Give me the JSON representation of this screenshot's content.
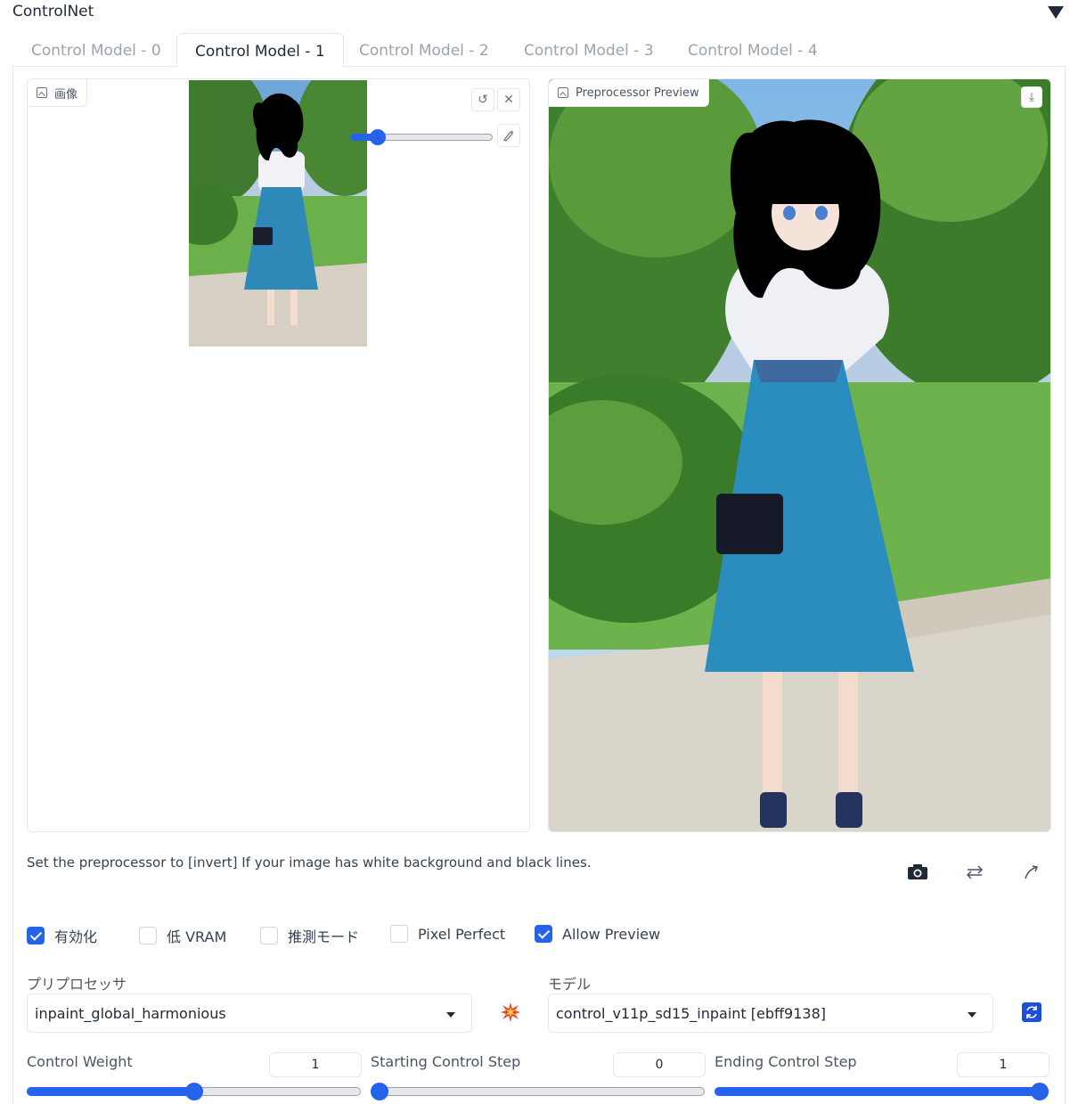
{
  "accordion": {
    "title": "ControlNet"
  },
  "tabs": [
    {
      "label": "Control Model - 0"
    },
    {
      "label": "Control Model - 1"
    },
    {
      "label": "Control Model - 2"
    },
    {
      "label": "Control Model - 3"
    },
    {
      "label": "Control Model - 4"
    }
  ],
  "image_panel": {
    "label": "画像"
  },
  "preview_panel": {
    "label": "Preprocessor Preview"
  },
  "hint": "Set the preprocessor to [invert] If your image has white background and black lines.",
  "checkboxes": [
    {
      "label": "有効化",
      "checked": true
    },
    {
      "label": "低 VRAM",
      "checked": false
    },
    {
      "label": "推測モード",
      "checked": false
    },
    {
      "label": "Pixel Perfect",
      "checked": false
    },
    {
      "label": "Allow Preview",
      "checked": true
    }
  ],
  "preprocessor": {
    "label": "プリプロセッサ",
    "value": "inpaint_global_harmonious"
  },
  "model": {
    "label": "モデル",
    "value": "control_v11p_sd15_inpaint [ebff9138]"
  },
  "sliders": [
    {
      "label": "Control Weight",
      "value": "1",
      "fraction": 0.5
    },
    {
      "label": "Starting Control Step",
      "value": "0",
      "fraction": 0.0
    },
    {
      "label": "Ending Control Step",
      "value": "1",
      "fraction": 1.0
    }
  ],
  "colors": {
    "accent": "#2563eb",
    "border": "#e5e7eb"
  }
}
